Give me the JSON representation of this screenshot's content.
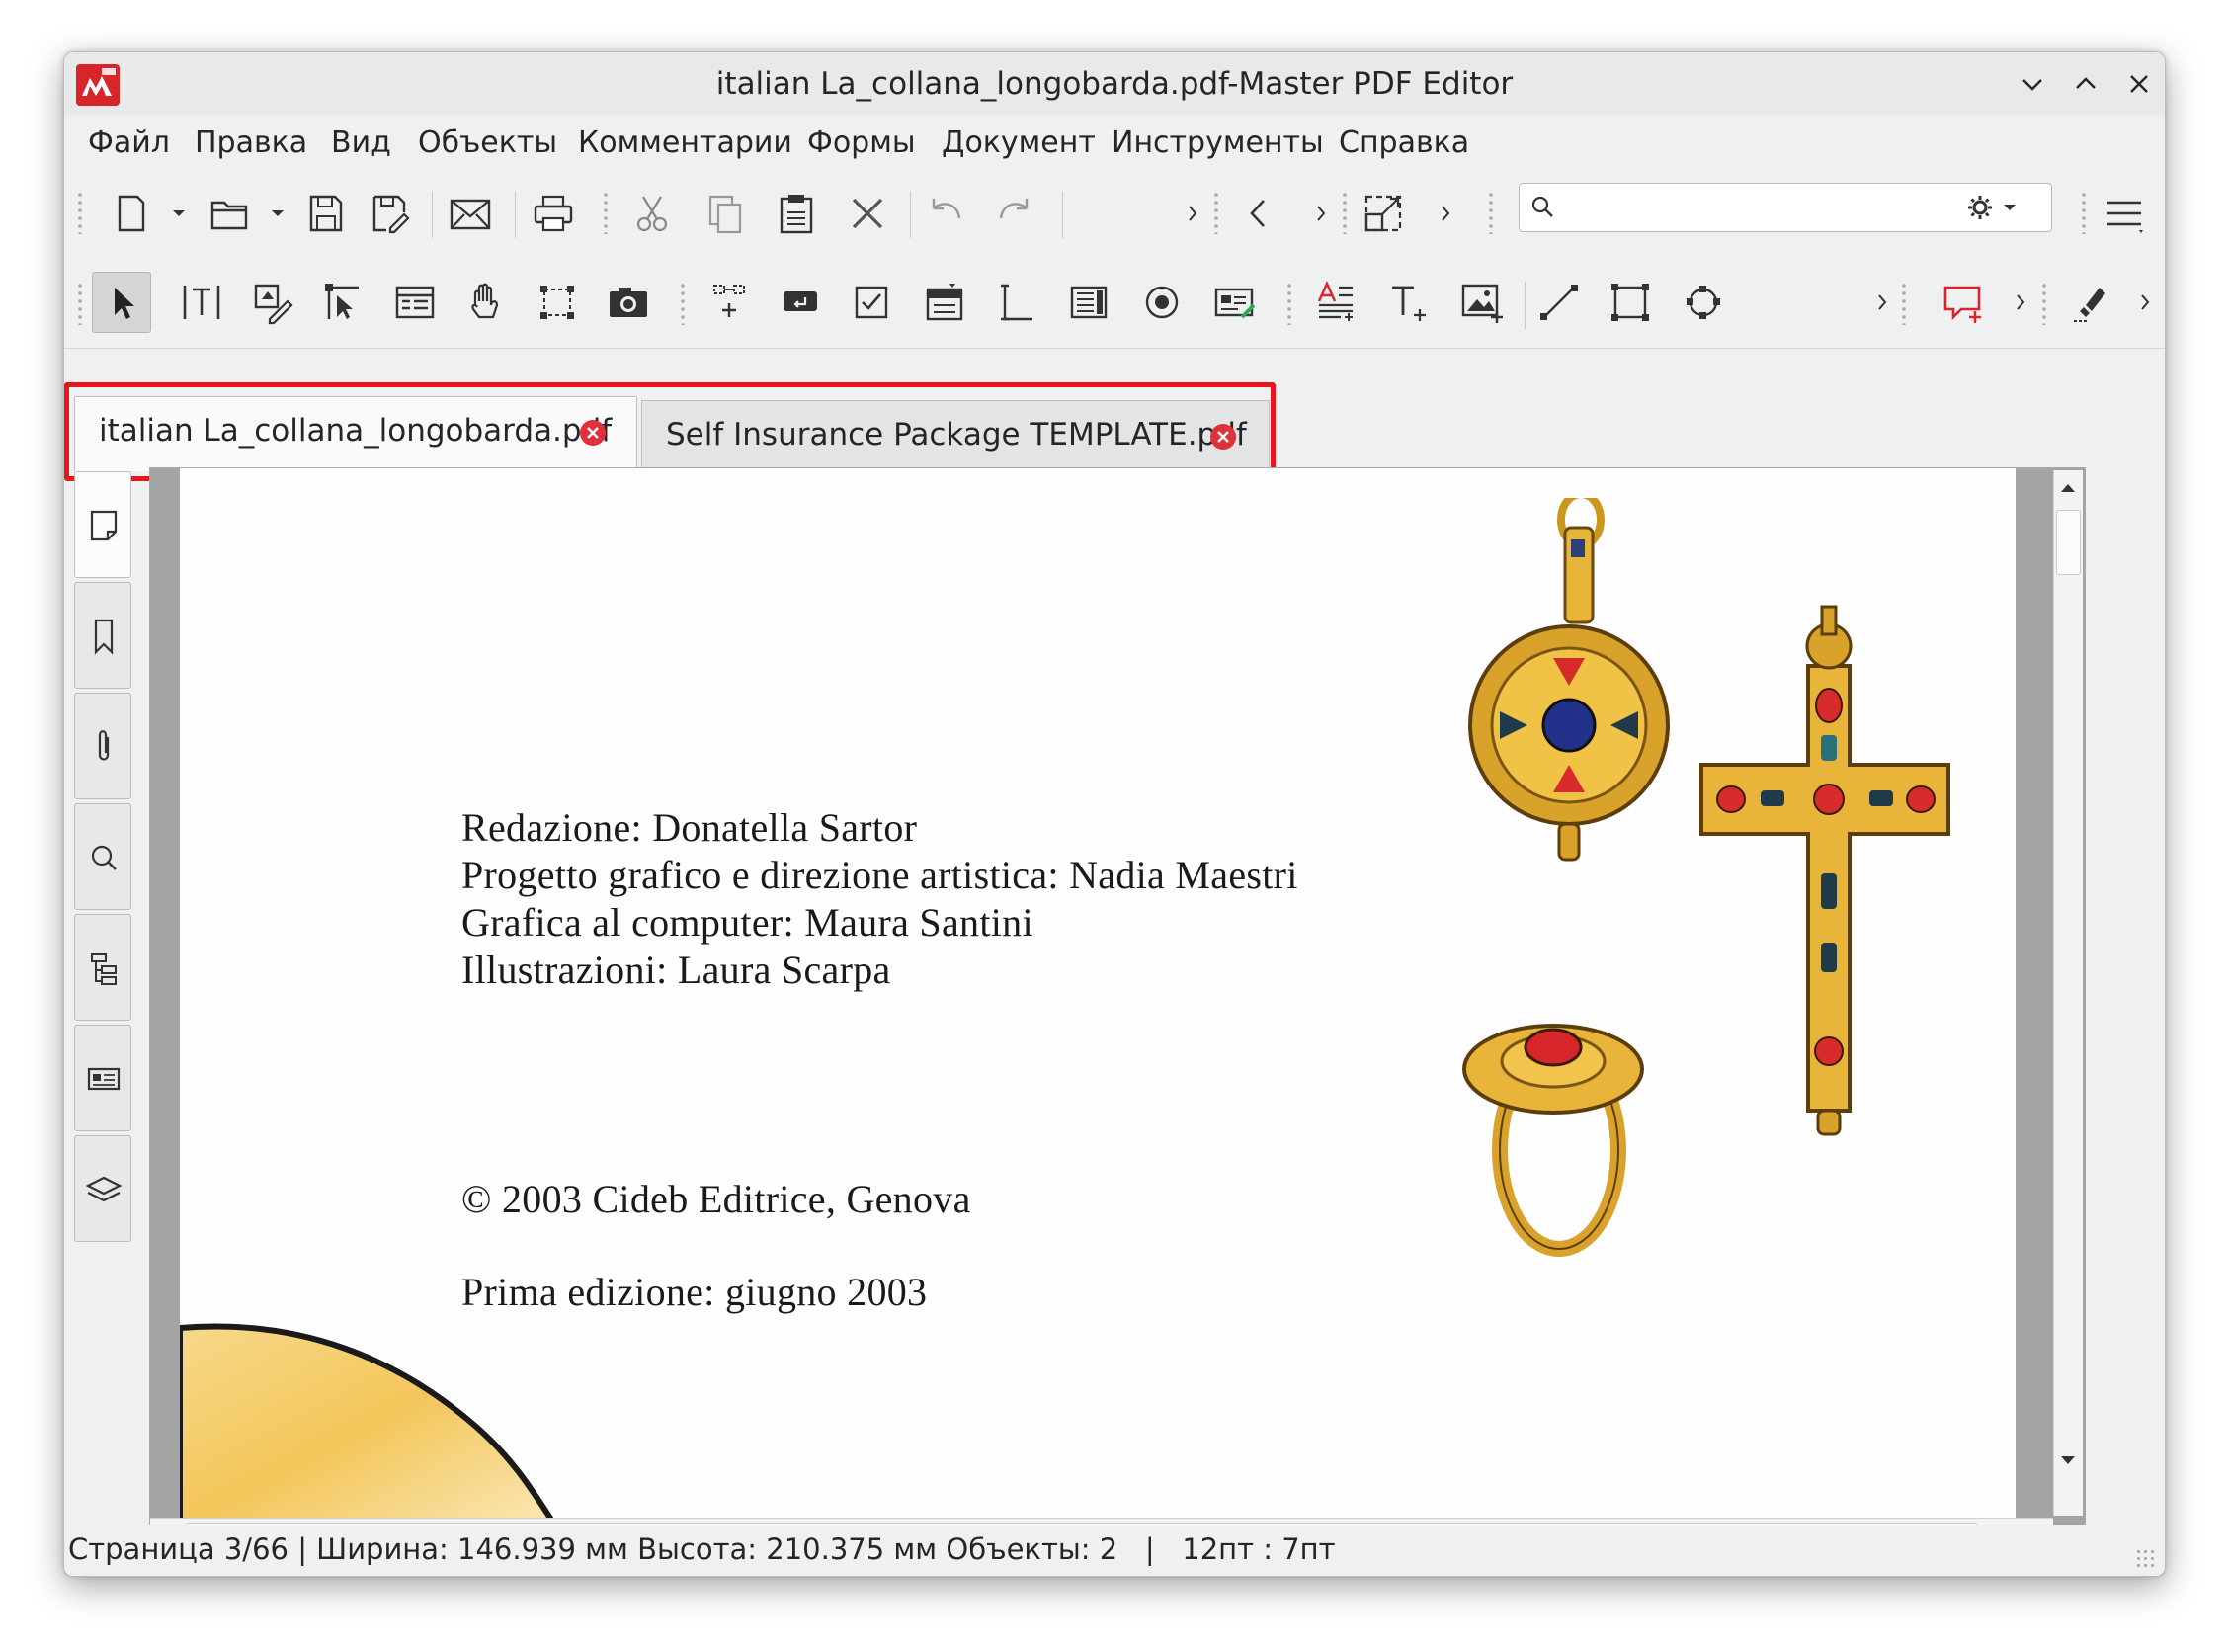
{
  "window": {
    "title": "italian La_collana_longobarda.pdf-Master PDF Editor"
  },
  "menu": {
    "items": [
      "Файл",
      "Правка",
      "Вид",
      "Объекты",
      "Комментарии",
      "Формы",
      "Документ",
      "Инструменты",
      "Справка"
    ]
  },
  "search": {
    "value": "",
    "placeholder": ""
  },
  "tabs": [
    {
      "label": "italian La_collana_longobarda.pdf",
      "active": true
    },
    {
      "label": "Self Insurance Package TEMPLATE.pdf",
      "active": false
    }
  ],
  "page": {
    "credits": [
      "Redazione: Donatella Sartor",
      "Progetto grafico e direzione artistica: Nadia Maestri",
      "Grafica al computer: Maura Santini",
      "Illustrazioni: Laura Scarpa"
    ],
    "copyright": "© 2003 Cideb Editrice, Genova",
    "edition": "Prima edizione: giugno 2003"
  },
  "status": {
    "text": "Страница 3/66 | Ширина: 146.939 мм Высота: 210.375 мм Объекты: 2   |   12пт : 7пт"
  },
  "colors": {
    "highlight": "#e8151a",
    "close_badge": "#e0303a",
    "app_logo": "#d8252a"
  },
  "icons": {
    "toolbar1": [
      "new-document-icon",
      "open-folder-icon",
      "save-icon",
      "save-as-icon",
      "email-icon",
      "print-icon",
      "cut-icon",
      "copy-icon",
      "paste-icon",
      "delete-icon",
      "undo-icon",
      "redo-icon",
      "prev-page-icon",
      "fit-page-icon",
      "search-icon",
      "gear-icon",
      "hamburger-menu-icon"
    ],
    "toolbar2": [
      "select-arrow-icon",
      "text-select-icon",
      "edit-object-icon",
      "edit-forms-icon",
      "forms-list-icon",
      "hand-pan-icon",
      "crop-icon",
      "snapshot-icon",
      "link-icon",
      "button-field-icon",
      "checkbox-field-icon",
      "combo-field-icon",
      "text-field-icon",
      "list-field-icon",
      "radio-field-icon",
      "signature-field-icon",
      "text-edit-icon",
      "add-text-icon",
      "add-image-icon",
      "line-icon",
      "rectangle-icon",
      "shape-icon",
      "comment-icon",
      "highlighter-icon"
    ]
  }
}
